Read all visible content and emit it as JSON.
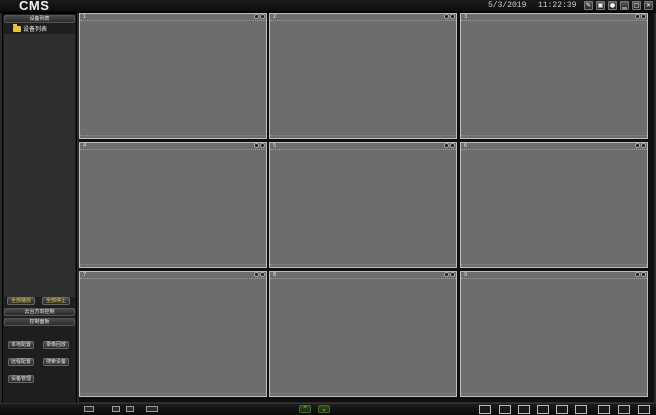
{
  "app": {
    "title": "CMS",
    "date": "5/3/2019",
    "time": "11:22:39"
  },
  "window_buttons": [
    {
      "name": "edit-icon",
      "glyph": "✎"
    },
    {
      "name": "lock-icon",
      "glyph": "▣"
    },
    {
      "name": "user-icon",
      "glyph": "●"
    },
    {
      "name": "minimize-icon",
      "glyph": "▁"
    },
    {
      "name": "maximize-icon",
      "glyph": "□"
    },
    {
      "name": "close-icon",
      "glyph": "✕"
    }
  ],
  "sidebar": {
    "device_list_header": "设备列表",
    "tree_root": "设备列表",
    "start_all": "全部播放",
    "stop_all": "全部停止",
    "ptz_header": "云台方向控制",
    "control_header": "控制面板",
    "buttons": [
      "本地配置",
      "录像回放",
      "远程配置",
      "搜索设备",
      "设备管理"
    ]
  },
  "grid": {
    "channels": [
      "1",
      "2",
      "3",
      "4",
      "5",
      "6",
      "7",
      "8",
      "9"
    ]
  },
  "bottom": {
    "up_arrow": "⌃",
    "down_arrow": "⌄",
    "layouts": [
      "1",
      "4",
      "9",
      "10",
      "13",
      "16",
      "25",
      "36",
      "64"
    ]
  }
}
